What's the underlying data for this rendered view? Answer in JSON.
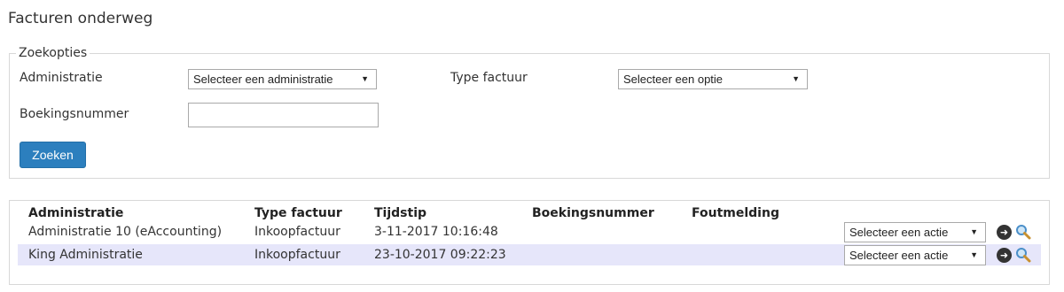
{
  "page": {
    "title": "Facturen onderweg"
  },
  "search": {
    "legend": "Zoekopties",
    "administratie_label": "Administratie",
    "administratie_value": "Selecteer een administratie",
    "type_label": "Type factuur",
    "type_value": "Selecteer een optie",
    "boekingsnummer_label": "Boekingsnummer",
    "boekingsnummer_value": "",
    "button": "Zoeken"
  },
  "results": {
    "columns": [
      "Administratie",
      "Type factuur",
      "Tijdstip",
      "Boekingsnummer",
      "Foutmelding"
    ],
    "rows": [
      {
        "administratie": "Administratie 10 (eAccounting)",
        "type": "Inkoopfactuur",
        "tijdstip": "3-11-2017 10:16:48",
        "boekingsnummer": "",
        "foutmelding": "",
        "action": "Selecteer een actie"
      },
      {
        "administratie": "King Administratie",
        "type": "Inkoopfactuur",
        "tijdstip": "23-10-2017 09:22:23",
        "boekingsnummer": "",
        "foutmelding": "",
        "action": "Selecteer een actie"
      }
    ]
  },
  "icons": {
    "go": "arrow-right-circle-icon",
    "search": "magnifier-icon"
  },
  "colors": {
    "button": "#2c7fbe",
    "row_highlight": "#e6e6fa"
  }
}
